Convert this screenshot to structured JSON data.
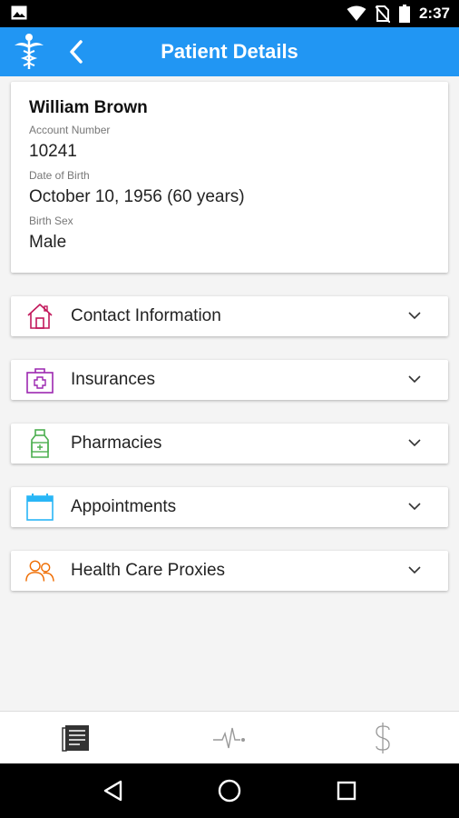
{
  "status_bar": {
    "time": "2:37",
    "icons": [
      "image-icon",
      "wifi-icon",
      "no-sim-icon",
      "battery-icon"
    ]
  },
  "app_bar": {
    "title": "Patient Details",
    "logo_icon": "caduceus-icon",
    "back_icon": "chevron-left-icon",
    "color": "#2196f3"
  },
  "patient": {
    "name": "William Brown",
    "account_label": "Account Number",
    "account_number": "10241",
    "dob_label": "Date of Birth",
    "dob": "October 10, 1956 (60 years)",
    "sex_label": "Birth Sex",
    "sex": "Male"
  },
  "sections": [
    {
      "label": "Contact Information",
      "icon": "house-icon",
      "color": "#c2185b"
    },
    {
      "label": "Insurances",
      "icon": "medical-briefcase-icon",
      "color": "#9c27b0"
    },
    {
      "label": "Pharmacies",
      "icon": "medicine-bottle-icon",
      "color": "#4caf50"
    },
    {
      "label": "Appointments",
      "icon": "calendar-icon",
      "color": "#29b6f6"
    },
    {
      "label": "Health Care Proxies",
      "icon": "people-icon",
      "color": "#ef6c00"
    }
  ],
  "bottom_nav": [
    {
      "icon": "document-icon",
      "active": true
    },
    {
      "icon": "heartbeat-icon",
      "active": false
    },
    {
      "icon": "dollar-icon",
      "active": false
    }
  ],
  "system_nav": [
    "back-triangle-icon",
    "home-circle-icon",
    "recents-square-icon"
  ]
}
